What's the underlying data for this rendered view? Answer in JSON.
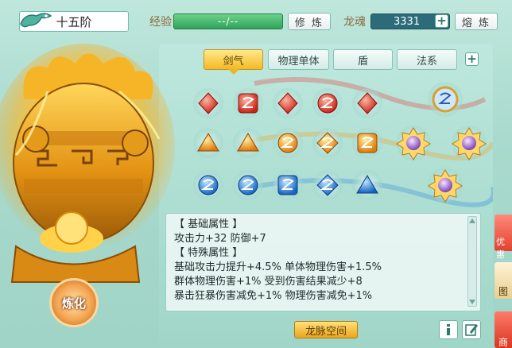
{
  "header": {
    "title": "十五阶",
    "exp_label": "经验",
    "exp_value": "--/--",
    "cultivate_button": "修 炼",
    "soul_label": "龙魂",
    "soul_value": "3331",
    "smelt_button": "熔 炼"
  },
  "tabs": [
    {
      "label": "剑气",
      "active": true
    },
    {
      "label": "物理单体",
      "active": false
    },
    {
      "label": "盾",
      "active": false
    },
    {
      "label": "法系",
      "active": false
    }
  ],
  "gems": {
    "row1_color": "#e84f3a",
    "row2_color": "#f5a021",
    "row3_color": "#2d8de0",
    "special_color": "#9c6fd6"
  },
  "attributes": {
    "basic_header": "【 基础属性 】",
    "basic_line": "攻击力+32  防御+7",
    "special_header": "【 特殊属性 】",
    "special_lines": [
      "基础攻击力提升+4.5%  单体物理伤害+1.5%",
      "群体物理伤害+1%  受到伤害结果减少+8",
      "暴击狂暴伤害减免+1%  物理伤害减免+1%"
    ]
  },
  "footer": {
    "space_button": "龙脉空间",
    "refine_button": "炼化"
  },
  "side_tabs": [
    {
      "label": "优惠"
    },
    {
      "label": "图"
    },
    {
      "label": "商"
    }
  ]
}
